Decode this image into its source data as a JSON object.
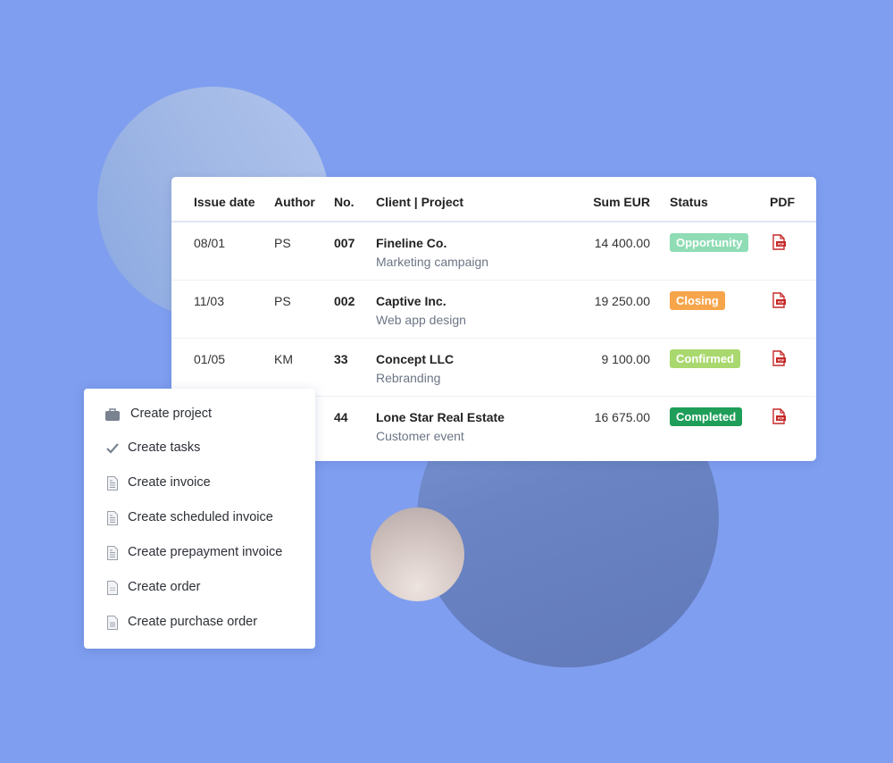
{
  "table": {
    "headers": {
      "issue_date": "Issue date",
      "author": "Author",
      "no": "No.",
      "client_project": "Client | Project",
      "sum": "Sum EUR",
      "status": "Status",
      "pdf": "PDF"
    },
    "rows": [
      {
        "issue_date": "08/01",
        "author": "PS",
        "no": "007",
        "client": "Fineline Co.",
        "project": "Marketing campaign",
        "sum": "14 400.00",
        "status": "Opportunity",
        "status_color": "#8fdcb5",
        "pdf_icon": "pdf-file-icon"
      },
      {
        "issue_date": "11/03",
        "author": "PS",
        "no": "002",
        "client": "Captive Inc.",
        "project": "Web app design",
        "sum": "19 250.00",
        "status": "Closing",
        "status_color": "#f6a54a",
        "pdf_icon": "pdf-file-icon"
      },
      {
        "issue_date": "01/05",
        "author": "KM",
        "no": "33",
        "client": "Concept LLC",
        "project": "Rebranding",
        "sum": "9 100.00",
        "status": "Confirmed",
        "status_color": "#a9d86e",
        "pdf_icon": "pdf-file-icon"
      },
      {
        "issue_date": "",
        "author": "",
        "no": "44",
        "client": "Lone Star Real Estate",
        "project": "Customer event",
        "sum": "16 675.00",
        "status": "Completed",
        "status_color": "#1f9e5a",
        "pdf_icon": "pdf-file-icon"
      }
    ]
  },
  "menu": {
    "items": [
      {
        "label": "Create project",
        "icon": "briefcase-icon"
      },
      {
        "label": "Create tasks",
        "icon": "checkmark-icon"
      },
      {
        "label": "Create invoice",
        "icon": "invoice-document-icon"
      },
      {
        "label": "Create scheduled invoice",
        "icon": "scheduled-invoice-document-icon"
      },
      {
        "label": "Create prepayment invoice",
        "icon": "prepayment-invoice-document-icon"
      },
      {
        "label": "Create order",
        "icon": "order-document-icon"
      },
      {
        "label": "Create purchase order",
        "icon": "purchase-order-document-icon"
      }
    ]
  },
  "colors": {
    "background": "#7f9ef0",
    "pdf_red": "#c62828"
  }
}
